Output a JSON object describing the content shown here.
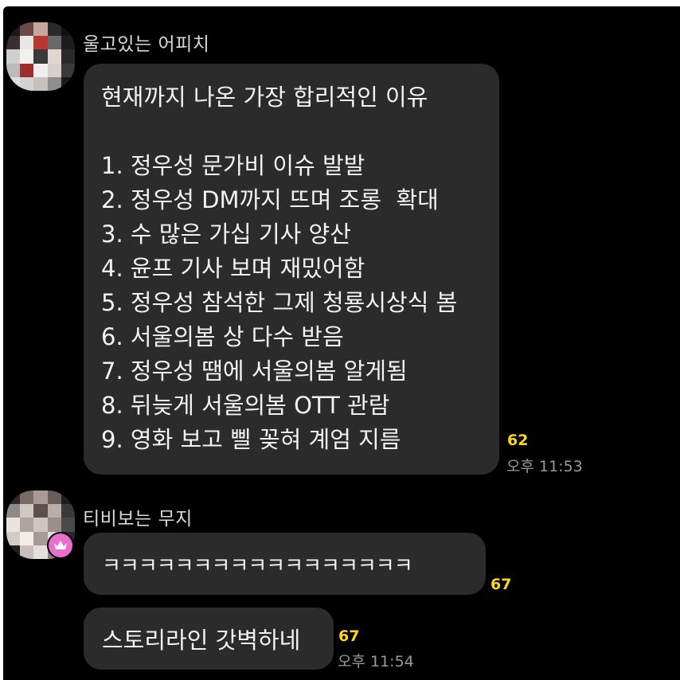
{
  "messages": [
    {
      "sender": "울고있는 어피치",
      "lines": [
        "현재까지 나온 가장 합리적인 이유",
        "",
        "1. 정우성 문가비 이슈 발발",
        "2. 정우성 DM까지 뜨며 조롱  확대",
        "3. 수 많은 가십 기사 양산",
        "4. 윤프 기사 보며 재밌어함",
        "5. 정우성 참석한 그제 청룡시상식 봄",
        "6. 서울의봄 상 다수 받음",
        "7. 정우성 땜에 서울의봄 알게됨",
        "8. 뒤늦게 서울의봄 OTT 관람",
        "9. 영화 보고 삘 꽂혀 계엄 지름"
      ],
      "unread_count": "62",
      "time": "오후 11:53"
    },
    {
      "sender": "티비보는 무지",
      "text": "ㅋㅋㅋㅋㅋㅋㅋㅋㅋㅋㅋㅋㅋㅋㅋㅋㅋ",
      "unread_count": "67"
    },
    {
      "text": "스토리라인 갓벽하네",
      "unread_count": "67",
      "time": "오후 11:54"
    }
  ],
  "icons": {
    "crown_badge": "crown-icon"
  },
  "colors": {
    "background": "#000000",
    "bubble": "#2b2b2b",
    "unread": "#ffd51a",
    "badge": "#e86fd0"
  }
}
